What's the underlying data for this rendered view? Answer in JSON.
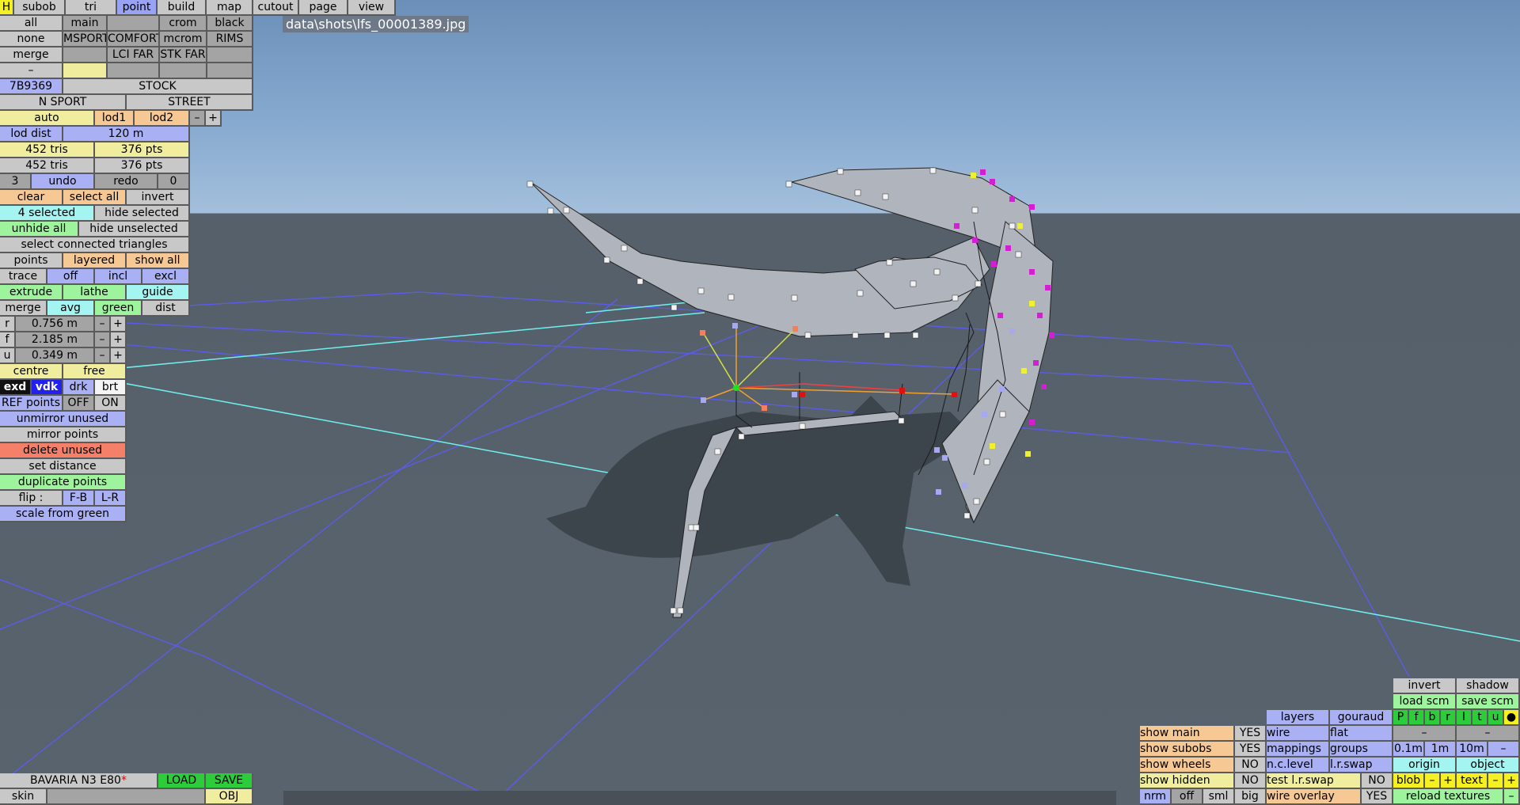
{
  "title": "data\\shots\\lfs_00001389.jpg",
  "menu": {
    "h": "H",
    "subob": "subob",
    "tri": "tri",
    "point": "point",
    "build": "build",
    "map": "map",
    "cutout": "cutout",
    "page": "page",
    "view": "view"
  },
  "rows": {
    "r2": [
      "all",
      "main",
      "",
      "crom",
      "black"
    ],
    "r3": [
      "none",
      "MSPORT",
      "COMFORT",
      "mcrom",
      "RIMS"
    ],
    "r4": [
      "merge",
      "",
      "LCI FAR",
      "STK FAR",
      ""
    ],
    "r5": [
      "–",
      "",
      "",
      "",
      ""
    ],
    "code": "7B9369",
    "stock": "STOCK",
    "nsport": "N SPORT",
    "street": "STREET"
  },
  "lod": {
    "auto": "auto",
    "lod1": "lod1",
    "lod2": "lod2",
    "minus": "–",
    "plus": "+",
    "dist_label": "lod dist",
    "dist_value": "120 m"
  },
  "counts": {
    "tris1": "452 tris",
    "pts1": "376 pts",
    "tris2": "452 tris",
    "pts2": "376 pts"
  },
  "undo": {
    "num": "3",
    "undo": "undo",
    "redo": "redo",
    "zero": "0"
  },
  "selection": {
    "clear": "clear",
    "select_all": "select all",
    "invert": "invert",
    "selected": "4 selected",
    "hide_selected": "hide selected",
    "unhide_all": "unhide all",
    "hide_unselected": "hide unselected",
    "select_connected": "select connected triangles",
    "points": "points",
    "layered": "layered",
    "show_all": "show all",
    "trace": "trace",
    "off": "off",
    "incl": "incl",
    "excl": "excl",
    "extrude": "extrude",
    "lathe": "lathe",
    "guide": "guide",
    "merge": "merge",
    "avg": "avg",
    "green": "green",
    "dist": "dist"
  },
  "coords": [
    {
      "axis": "r",
      "value": "0.756 m"
    },
    {
      "axis": "f",
      "value": "2.185 m"
    },
    {
      "axis": "u",
      "value": "0.349 m"
    }
  ],
  "step": {
    "minus": "–",
    "plus": "+"
  },
  "pivot": {
    "centre": "centre",
    "free": "free"
  },
  "exd": {
    "exd": "exd",
    "vdk": "vdk",
    "drk": "drk",
    "brt": "brt"
  },
  "ref": {
    "label": "REF points",
    "off": "OFF",
    "on": "ON"
  },
  "tools": {
    "unmirror": "unmirror unused",
    "mirror": "mirror points",
    "delete": "delete unused",
    "setdist": "set distance",
    "duplicate": "duplicate points",
    "flip": "flip :",
    "fb": "F-B",
    "lr": "L-R",
    "scale": "scale from green"
  },
  "car": {
    "name": "BAVARIA N3 E80",
    "star": "*",
    "load": "LOAD",
    "save": "SAVE",
    "skin": "skin",
    "obj": "OBJ"
  },
  "right": {
    "invert": "invert",
    "shadow": "shadow",
    "load_scm": "load scm",
    "save_scm": "save scm",
    "layers": "layers",
    "gouraud": "gouraud",
    "letters": [
      "P",
      "f",
      "b",
      "r",
      "l",
      "t",
      "u",
      "●"
    ],
    "dash1": "–",
    "dash2": "–",
    "show_main": "show main",
    "show_main_v": "YES",
    "wire": "wire",
    "flat": "flat",
    "show_subobs": "show subobs",
    "show_subobs_v": "YES",
    "mappings": "mappings",
    "groups": "groups",
    "s01": "0.1m",
    "s1": "1m",
    "s10": "10m",
    "sminus": "–",
    "show_wheels": "show wheels",
    "show_wheels_v": "NO",
    "nclevel": "n.c.level",
    "lrswap": "l.r.swap",
    "origin": "origin",
    "object": "object",
    "show_hidden": "show hidden",
    "show_hidden_v": "NO",
    "test_lrswap": "test l.r.swap",
    "test_lrswap_v": "NO",
    "blob": "blob",
    "text": "text",
    "pm_minus": "–",
    "pm_plus": "+",
    "nrm": "nrm",
    "off": "off",
    "sml": "sml",
    "big": "big",
    "wire_overlay": "wire overlay",
    "wire_overlay_v": "YES",
    "reload": "reload textures",
    "rl_minus": "–"
  }
}
